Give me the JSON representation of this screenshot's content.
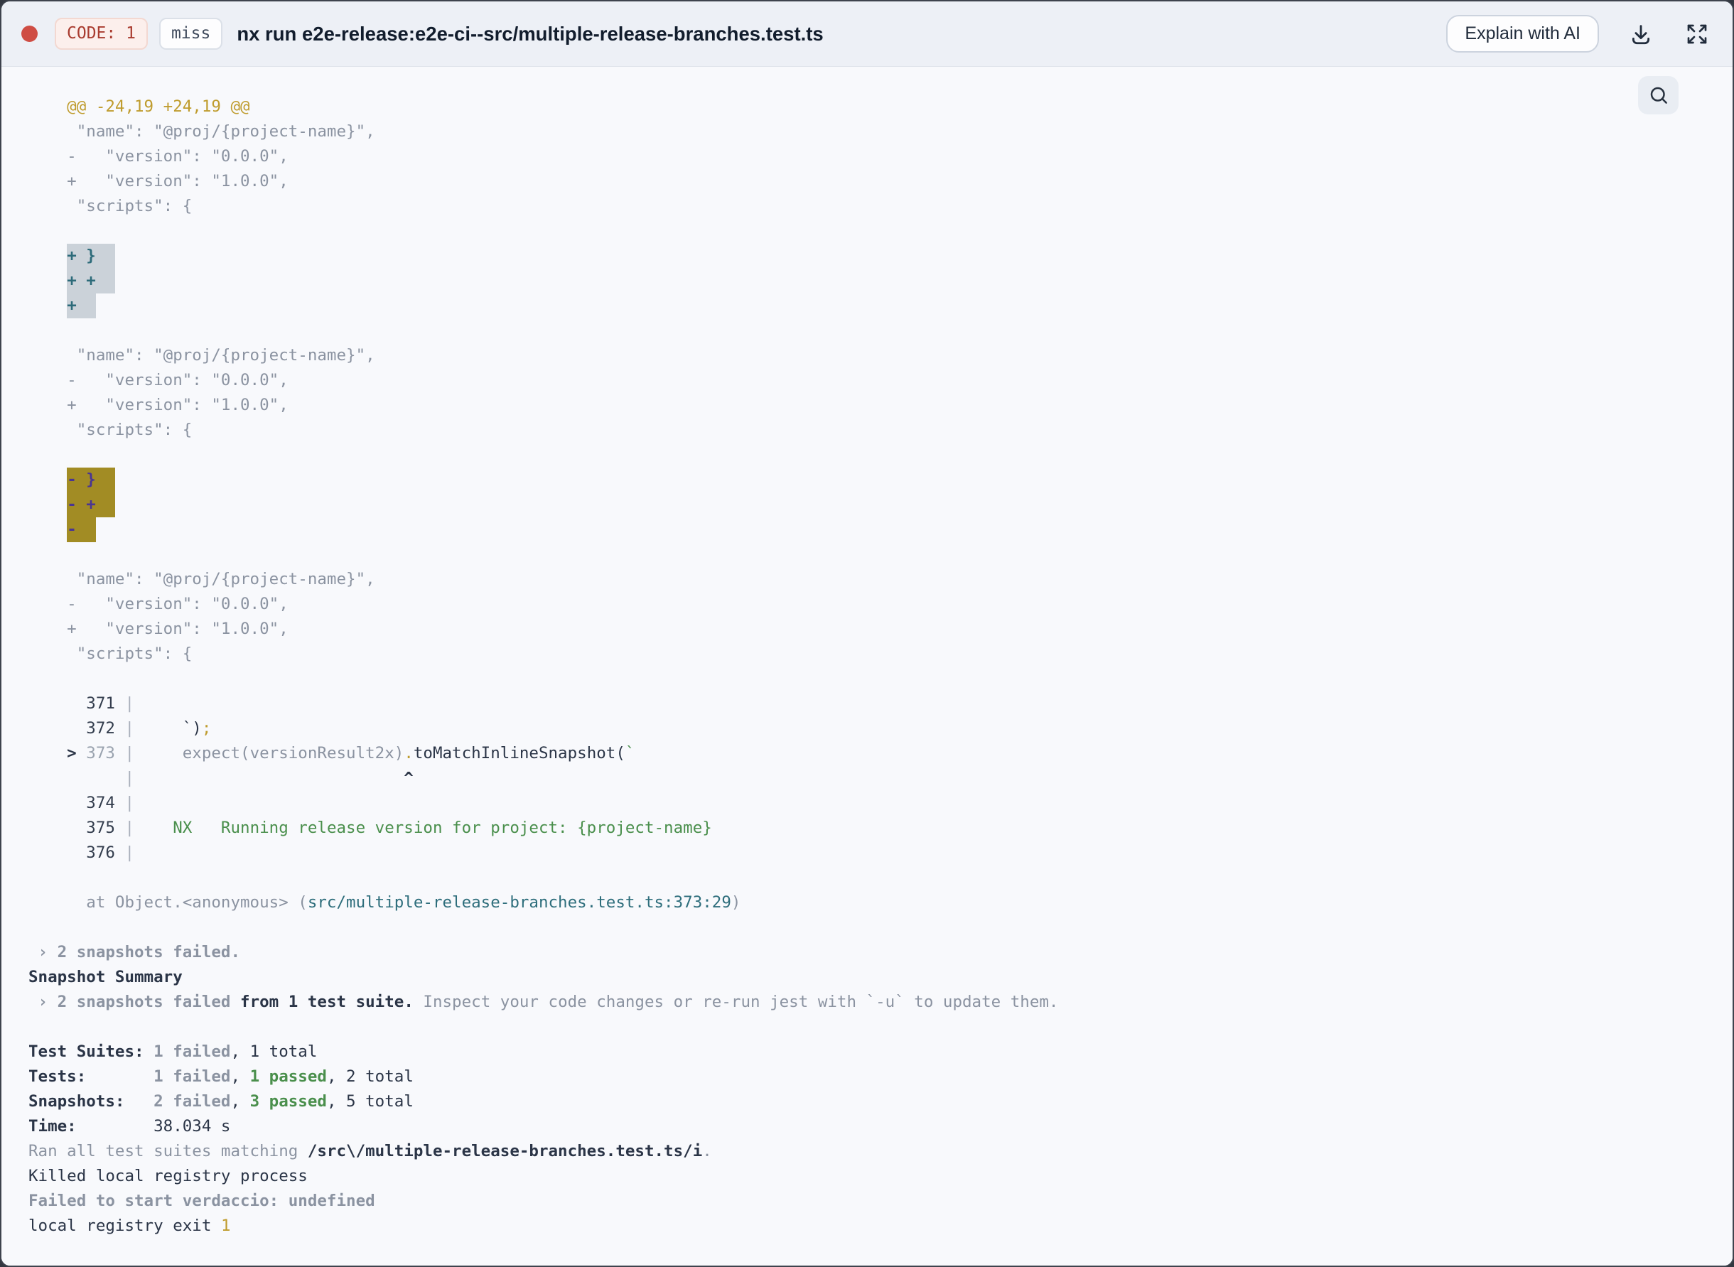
{
  "header": {
    "code_badge": "CODE: 1",
    "cache_badge": "miss",
    "title": "nx run e2e-release:e2e-ci--src/multiple-release-branches.test.ts",
    "explain_button": "Explain with AI"
  },
  "colors": {
    "status_dot": "#cf4d44",
    "exit_code_text": "#a93c30",
    "diff_hunk_gold": "#bf9c2e",
    "pass_green": "#4a8f4c",
    "file_path_teal": "#2e6e7c",
    "match_highlight_bg": "#cbd2d9",
    "match_highlight_text": "#2d6b7a",
    "current_match_bg": "#a28c24",
    "current_match_text": "#4a3593",
    "header_bg": "#edf0f6",
    "content_bg": "#f8f9fc"
  },
  "icons": {
    "status_dot": "red-circle",
    "download": "download-tray-arrow",
    "expand": "expand-corner-arrows",
    "search": "magnifier"
  },
  "terminal": {
    "lines": [
      {
        "segments": [
          {
            "t": "    @@ -24,19 +24,19 @@",
            "s": "gold"
          }
        ]
      },
      {
        "segments": [
          {
            "t": "     \"name\": \"@proj/{project-name}\",",
            "s": "gray"
          }
        ]
      },
      {
        "segments": [
          {
            "t": "    -   \"version\": \"0.0.0\",",
            "s": "gray"
          }
        ]
      },
      {
        "segments": [
          {
            "t": "    +   \"version\": \"1.0.0\",",
            "s": "gray"
          }
        ]
      },
      {
        "segments": [
          {
            "t": "     \"scripts\": {",
            "s": "gray"
          }
        ]
      },
      {
        "segments": []
      },
      {
        "segments": [
          {
            "t": "    ",
            "s": "gray"
          },
          {
            "t": "+ }  ",
            "s": "hlplus"
          }
        ]
      },
      {
        "segments": [
          {
            "t": "    ",
            "s": "gray"
          },
          {
            "t": "+ +  ",
            "s": "hlplus"
          }
        ]
      },
      {
        "segments": [
          {
            "t": "    ",
            "s": "gray"
          },
          {
            "t": "+  ",
            "s": "hlplus"
          }
        ]
      },
      {
        "segments": []
      },
      {
        "segments": [
          {
            "t": "     \"name\": \"@proj/{project-name}\",",
            "s": "gray"
          }
        ]
      },
      {
        "segments": [
          {
            "t": "    -   \"version\": \"0.0.0\",",
            "s": "gray"
          }
        ]
      },
      {
        "segments": [
          {
            "t": "    +   \"version\": \"1.0.0\",",
            "s": "gray"
          }
        ]
      },
      {
        "segments": [
          {
            "t": "     \"scripts\": {",
            "s": "gray"
          }
        ]
      },
      {
        "segments": []
      },
      {
        "segments": [
          {
            "t": "    ",
            "s": "gray"
          },
          {
            "t": "- }  ",
            "s": "hlminus"
          }
        ]
      },
      {
        "segments": [
          {
            "t": "    ",
            "s": "gray"
          },
          {
            "t": "- +  ",
            "s": "hlminus"
          }
        ]
      },
      {
        "segments": [
          {
            "t": "    ",
            "s": "gray"
          },
          {
            "t": "-  ",
            "s": "hlminus"
          }
        ]
      },
      {
        "segments": []
      },
      {
        "segments": [
          {
            "t": "     \"name\": \"@proj/{project-name}\",",
            "s": "gray"
          }
        ]
      },
      {
        "segments": [
          {
            "t": "    -   \"version\": \"0.0.0\",",
            "s": "gray"
          }
        ]
      },
      {
        "segments": [
          {
            "t": "    +   \"version\": \"1.0.0\",",
            "s": "gray"
          }
        ]
      },
      {
        "segments": [
          {
            "t": "     \"scripts\": {",
            "s": "gray"
          }
        ]
      },
      {
        "segments": []
      },
      {
        "segments": [
          {
            "t": "      371",
            "s": "num"
          },
          {
            "t": " |",
            "s": "pipe"
          }
        ]
      },
      {
        "segments": [
          {
            "t": "      372",
            "s": "num"
          },
          {
            "t": " |",
            "s": "pipe"
          },
          {
            "t": "     `)",
            "s": "dark"
          },
          {
            "t": ";",
            "s": "gold"
          }
        ]
      },
      {
        "segments": [
          {
            "t": "    > ",
            "s": "darkb"
          },
          {
            "t": "373",
            "s": "numdim"
          },
          {
            "t": " |",
            "s": "pipe"
          },
          {
            "t": "     expect(versionResult2x)",
            "s": "gray"
          },
          {
            "t": ".",
            "s": "gold"
          },
          {
            "t": "toMatchInlineSnapshot(",
            "s": "dark"
          },
          {
            "t": "`",
            "s": "green"
          }
        ]
      },
      {
        "segments": [
          {
            "t": "          |",
            "s": "pipe"
          },
          {
            "t": "                            ^",
            "s": "caret"
          }
        ]
      },
      {
        "segments": [
          {
            "t": "      374",
            "s": "num"
          },
          {
            "t": " |",
            "s": "pipe"
          }
        ]
      },
      {
        "segments": [
          {
            "t": "      375",
            "s": "num"
          },
          {
            "t": " |",
            "s": "pipe"
          },
          {
            "t": "    NX   Running release version for project: {project-name}",
            "s": "green"
          }
        ]
      },
      {
        "segments": [
          {
            "t": "      376",
            "s": "num"
          },
          {
            "t": " |",
            "s": "pipe"
          }
        ]
      },
      {
        "segments": []
      },
      {
        "segments": [
          {
            "t": "      at Object.<anonymous> (",
            "s": "gray"
          },
          {
            "t": "src/multiple-release-branches.test.ts:373:29",
            "s": "teal"
          },
          {
            "t": ")",
            "s": "gray"
          }
        ]
      },
      {
        "segments": []
      },
      {
        "segments": [
          {
            "t": " › 2 snapshots failed.",
            "s": "grayb"
          }
        ]
      },
      {
        "segments": [
          {
            "t": "Snapshot Summary",
            "s": "darkb"
          }
        ]
      },
      {
        "segments": [
          {
            "t": " › 2 snapshots failed",
            "s": "grayb"
          },
          {
            "t": " from 1 test suite.",
            "s": "darkb"
          },
          {
            "t": " Inspect your code changes or re-run jest with `-u` to update them.",
            "s": "gray"
          }
        ]
      },
      {
        "segments": []
      },
      {
        "segments": [
          {
            "t": "Test Suites: ",
            "s": "darkb"
          },
          {
            "t": "1 failed",
            "s": "grayb"
          },
          {
            "t": ", 1 total",
            "s": "dark"
          }
        ]
      },
      {
        "segments": [
          {
            "t": "Tests:       ",
            "s": "darkb"
          },
          {
            "t": "1 failed",
            "s": "grayb"
          },
          {
            "t": ", ",
            "s": "dark"
          },
          {
            "t": "1 passed",
            "s": "greenb"
          },
          {
            "t": ", 2 total",
            "s": "dark"
          }
        ]
      },
      {
        "segments": [
          {
            "t": "Snapshots:   ",
            "s": "darkb"
          },
          {
            "t": "2 failed",
            "s": "grayb"
          },
          {
            "t": ", ",
            "s": "dark"
          },
          {
            "t": "3 passed",
            "s": "greenb"
          },
          {
            "t": ", 5 total",
            "s": "dark"
          }
        ]
      },
      {
        "segments": [
          {
            "t": "Time:        ",
            "s": "darkb"
          },
          {
            "t": "38.034 s",
            "s": "dark"
          }
        ]
      },
      {
        "segments": [
          {
            "t": "Ran all test suites matching ",
            "s": "gray"
          },
          {
            "t": "/src\\/multiple-release-branches.test.ts/i",
            "s": "darkb"
          },
          {
            "t": ".",
            "s": "gray"
          }
        ]
      },
      {
        "segments": [
          {
            "t": "Killed local registry process",
            "s": "dark"
          }
        ]
      },
      {
        "segments": [
          {
            "t": "Failed to start verdaccio: undefined",
            "s": "grayb"
          }
        ]
      },
      {
        "segments": [
          {
            "t": "local registry exit ",
            "s": "dark"
          },
          {
            "t": "1",
            "s": "gold"
          }
        ]
      }
    ]
  }
}
